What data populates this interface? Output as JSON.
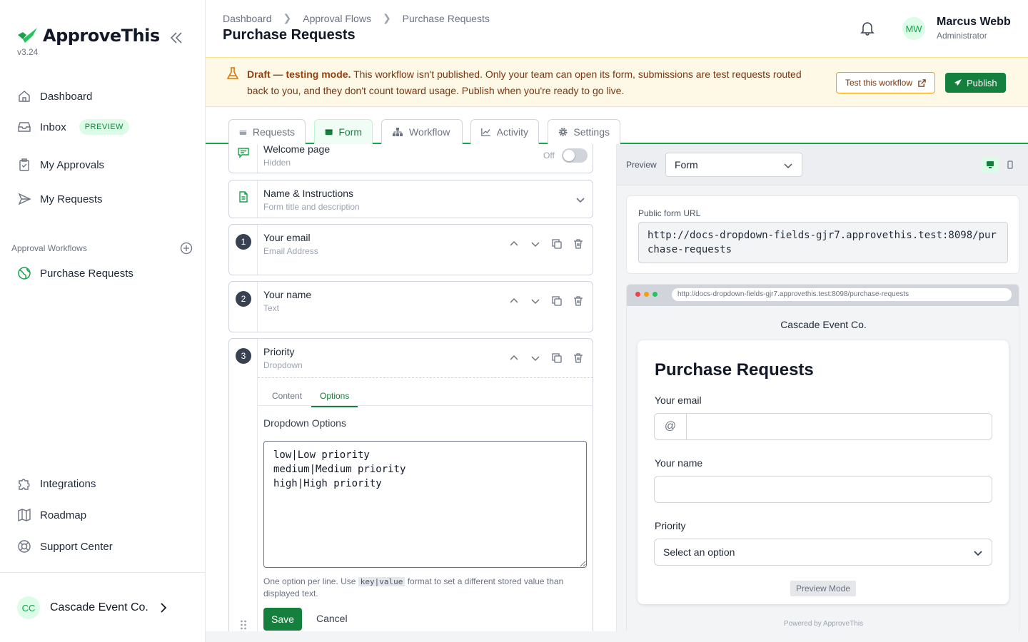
{
  "app": {
    "name": "ApproveThis",
    "version": "v3.24"
  },
  "sidebar": {
    "nav": [
      {
        "label": "Dashboard",
        "icon": "home-icon"
      },
      {
        "label": "Inbox",
        "badge": "PREVIEW",
        "icon": "inbox-icon"
      },
      {
        "label": "My Approvals",
        "icon": "clipboard-check-icon"
      },
      {
        "label": "My Requests",
        "icon": "send-icon"
      }
    ],
    "section_label": "Approval Workflows",
    "workflows": [
      {
        "label": "Purchase Requests",
        "icon": "globe-icon"
      }
    ],
    "footer_nav": [
      {
        "label": "Integrations",
        "icon": "puzzle-icon"
      },
      {
        "label": "Roadmap",
        "icon": "map-icon"
      },
      {
        "label": "Support Center",
        "icon": "lifebuoy-icon"
      }
    ],
    "org": {
      "initials": "CC",
      "name": "Cascade Event Co."
    }
  },
  "header": {
    "breadcrumb": [
      "Dashboard",
      "Approval Flows",
      "Purchase Requests"
    ],
    "title": "Purchase Requests",
    "user": {
      "initials": "MW",
      "name": "Marcus Webb",
      "role": "Administrator"
    }
  },
  "banner": {
    "strong": "Draft — testing mode.",
    "text": " This workflow isn't published. Only your team can open its form, submissions are test requests routed back to you, and they don't count toward usage. Publish when you're ready to go live.",
    "test_label": "Test this workflow",
    "publish_label": "Publish"
  },
  "tabs": [
    {
      "label": "Requests",
      "icon": "inbox-tray-icon",
      "active": false
    },
    {
      "label": "Form",
      "icon": "form-card-icon",
      "active": true
    },
    {
      "label": "Workflow",
      "icon": "sitemap-icon",
      "active": false
    },
    {
      "label": "Activity",
      "icon": "chart-line-icon",
      "active": false
    },
    {
      "label": "Settings",
      "icon": "gear-icon",
      "active": false
    }
  ],
  "editor": {
    "welcome": {
      "title": "Welcome page",
      "sub": "Hidden",
      "toggle": "Off"
    },
    "name_instructions": {
      "title": "Name & Instructions",
      "sub": "Form title and description"
    },
    "fields": [
      {
        "num": "1",
        "title": "Your email",
        "sub": "Email Address"
      },
      {
        "num": "2",
        "title": "Your name",
        "sub": "Text"
      },
      {
        "num": "3",
        "title": "Priority",
        "sub": "Dropdown"
      }
    ],
    "subtabs": {
      "content": "Content",
      "options": "Options"
    },
    "dropdown_label": "Dropdown Options",
    "dropdown_options": "low|Low priority\nmedium|Medium priority\nhigh|High priority",
    "help_before": "One option per line. Use ",
    "help_code": "key|value",
    "help_after": " format to set a different stored value than displayed text.",
    "save": "Save",
    "cancel": "Cancel"
  },
  "preview": {
    "label": "Preview",
    "mode": "Form",
    "url_label": "Public form URL",
    "url": "http://docs-dropdown-fields-gjr7.approvethis.test:8098/purchase-requests",
    "browser_url": "http://docs-dropdown-fields-gjr7.approvethis.test:8098/purchase-requests",
    "brand": "Cascade Event Co.",
    "form_title": "Purchase Requests",
    "email_label": "Your email",
    "at": "@",
    "name_label": "Your name",
    "priority_label": "Priority",
    "priority_placeholder": "Select an option",
    "preview_mode": "Preview Mode",
    "powered": "Powered by ApproveThis"
  },
  "colors": {
    "brand_green": "#15803d",
    "accent_green": "#16a34a",
    "banner_bg": "#fef9e7",
    "banner_border": "#f59e0b"
  }
}
